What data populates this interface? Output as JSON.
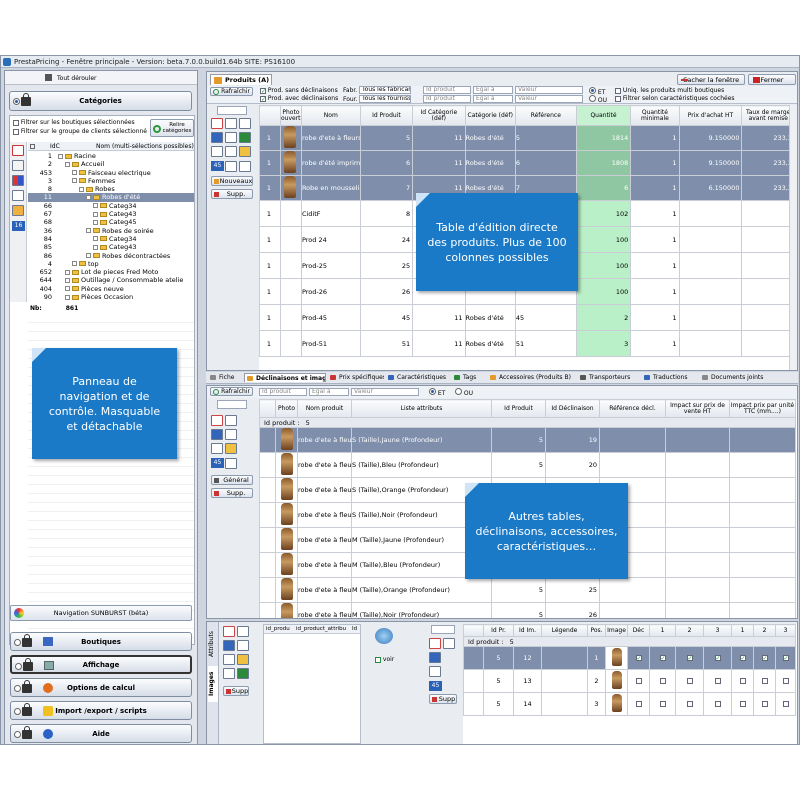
{
  "window": {
    "title": "PrestaPricing - Fenêtre principale  -  Version: beta.7.0.0.build1.64b  SITE: PS16100"
  },
  "left": {
    "expand_all": "Tout dérouler",
    "section": "Catégories",
    "filter_shops": "Filtrer sur les boutiques sélectionnées",
    "filter_groups": "Filtrer sur le groupe de clients sélectionné",
    "reread": "Relire catégories",
    "col_idc": "IdC",
    "col_name": "Nom",
    "col_name_hint": "(multi-sélections possibles)",
    "tree": [
      {
        "id": "1",
        "name": "Racine",
        "level": 0
      },
      {
        "id": "2",
        "name": "Accueil",
        "level": 1
      },
      {
        "id": "453",
        "name": "Faisceau electrique",
        "level": 2
      },
      {
        "id": "3",
        "name": "Femmes",
        "level": 2
      },
      {
        "id": "8",
        "name": "Robes",
        "level": 3
      },
      {
        "id": "11",
        "name": "Robes d'été",
        "level": 4,
        "selected": true
      },
      {
        "id": "66",
        "name": "Categ34",
        "level": 5
      },
      {
        "id": "67",
        "name": "Categ43",
        "level": 5
      },
      {
        "id": "68",
        "name": "Categ45",
        "level": 5
      },
      {
        "id": "36",
        "name": "Robes de soirée",
        "level": 4
      },
      {
        "id": "84",
        "name": "Categ34",
        "level": 5
      },
      {
        "id": "85",
        "name": "Categ43",
        "level": 5
      },
      {
        "id": "86",
        "name": "Robes décontractées",
        "level": 4
      },
      {
        "id": "4",
        "name": "top",
        "level": 2
      },
      {
        "id": "652",
        "name": "Lot de pieces Fred Moto",
        "level": 1
      },
      {
        "id": "644",
        "name": "Outillage / Consommable atelie",
        "level": 1
      },
      {
        "id": "404",
        "name": "Pièces neuve",
        "level": 1
      },
      {
        "id": "90",
        "name": "Pièces Occasion",
        "level": 1
      }
    ],
    "count_label": "Nb:",
    "count": "861",
    "side_badge": "16",
    "sunburst": "Navigation SUNBURST (béta)",
    "buttons": [
      "Boutiques",
      "Affichage",
      "Options de calcul",
      "Import /export / scripts",
      "Aide"
    ]
  },
  "products": {
    "tab": "Produits (A)",
    "hide_window": "Cacher la fenêtre",
    "close": "Fermer",
    "refresh": "Rafraîchir",
    "chk_no_decl": "Prod. sans déclinaisons",
    "chk_with_decl": "Prod. avec déclinaisons",
    "lbl_fabr": "Fabr.",
    "lbl_four": "Four.",
    "sel_fabr": "Tous les fabricant",
    "sel_four": "Tous les fournisse",
    "ph_idprod": "Id produit",
    "ph_equal": "Egal à",
    "ph_value": "Valeur",
    "opt_et": "ET",
    "opt_ou": "OU",
    "chk_multi": "Uniq. les produits multi boutiques",
    "chk_feat": "Filtrer selon caractéristiques cochées",
    "btn_new": "Nouveaux",
    "btn_del": "Supp.",
    "badge": "45",
    "headers": [
      "",
      "Photo ouverture",
      "Nom",
      "Id Produit",
      "Id Catégorie (déf)",
      "Catégorie (déf)",
      "Référence",
      "Quantité",
      "Quantité minimale",
      "Prix d'achat HT",
      "Taux de marge avant remise"
    ],
    "rows": [
      {
        "c": "1",
        "name": "robe d'ete à fleurs",
        "id": "5",
        "cat": "11",
        "catn": "Robes d'été",
        "ref": "5",
        "qty": "1814",
        "min": "1",
        "price": "9.150000",
        "rate": "233,3",
        "sel": true,
        "img": true
      },
      {
        "c": "1",
        "name": "robe d'été imprimé",
        "id": "6",
        "cat": "11",
        "catn": "Robes d'été",
        "ref": "6",
        "qty": "1808",
        "min": "1",
        "price": "9.150000",
        "rate": "233,3",
        "sel": true,
        "img": true
      },
      {
        "c": "1",
        "name": "Robe en mousselin",
        "id": "7",
        "cat": "11",
        "catn": "Robes d'été",
        "ref": "7",
        "qty": "6",
        "min": "1",
        "price": "6.150000",
        "rate": "233,3",
        "sel": true,
        "img": true
      },
      {
        "c": "1",
        "name": "CiditF",
        "id": "8",
        "cat": "",
        "catn": "",
        "ref": "",
        "qty": "102",
        "min": "1",
        "price": "",
        "rate": "",
        "sel": false,
        "img": false
      },
      {
        "c": "1",
        "name": "Prod 24",
        "id": "24",
        "cat": "",
        "catn": "",
        "ref": "",
        "qty": "100",
        "min": "1",
        "price": "",
        "rate": "",
        "sel": false,
        "img": false
      },
      {
        "c": "1",
        "name": "Prod-25",
        "id": "25",
        "cat": "",
        "catn": "",
        "ref": "",
        "qty": "100",
        "min": "1",
        "price": "",
        "rate": "",
        "sel": false,
        "img": false
      },
      {
        "c": "1",
        "name": "Prod-26",
        "id": "26",
        "cat": "",
        "catn": "",
        "ref": "",
        "qty": "100",
        "min": "1",
        "price": "",
        "rate": "",
        "sel": false,
        "img": false
      },
      {
        "c": "1",
        "name": "Prod-45",
        "id": "45",
        "cat": "11",
        "catn": "Robes d'été",
        "ref": "45",
        "qty": "2",
        "min": "1",
        "price": "",
        "rate": "",
        "sel": false,
        "img": false
      },
      {
        "c": "1",
        "name": "Prod-51",
        "id": "51",
        "cat": "11",
        "catn": "Robes d'été",
        "ref": "51",
        "qty": "3",
        "min": "1",
        "price": "",
        "rate": "",
        "sel": false,
        "img": false
      }
    ]
  },
  "tabs": [
    "Fiche",
    "Déclinaisons et images",
    "Prix spécifiques",
    "Caractéristiques",
    "Tags",
    "Accessoires (Produits B)",
    "Transporteurs",
    "Traductions",
    "Documents joints"
  ],
  "decl": {
    "refresh": "Rafraîchir",
    "ph_idprod": "Id produit",
    "ph_equal": "Egal à",
    "ph_value": "Valeur",
    "opt_et": "ET",
    "opt_ou": "OU",
    "btn_general": "Général",
    "btn_del": "Supp.",
    "badge": "45",
    "group_label": "Id produit :",
    "group_value": "5",
    "headers": [
      "Photo",
      "Nom produit",
      "Liste attributs",
      "Id Produit",
      "Id Déclinaison",
      "Référence décl.",
      "Impact sur prix de vente HT",
      "Impact prix par unité TTC (mm....)"
    ],
    "rows": [
      {
        "name": "robe d'ete à fleurs",
        "attrs": "S (Taille),Jaune (Profondeur)",
        "pid": "5",
        "did": "19",
        "sel": true
      },
      {
        "name": "robe d'ete à fleurs",
        "attrs": "S (Taille),Bleu (Profondeur)",
        "pid": "5",
        "did": "20",
        "sel": false
      },
      {
        "name": "robe d'ete à fleurs",
        "attrs": "S (Taille),Orange (Profondeur)",
        "pid": "5",
        "did": "21",
        "sel": false
      },
      {
        "name": "robe d'ete à fleurs",
        "attrs": "S (Taille),Noir (Profondeur)",
        "pid": "5",
        "did": "22",
        "sel": false
      },
      {
        "name": "robe d'ete à fleurs",
        "attrs": "M (Taille),Jaune (Profondeur)",
        "pid": "5",
        "did": "23",
        "sel": false
      },
      {
        "name": "robe d'ete à fleurs",
        "attrs": "M (Taille),Bleu (Profondeur)",
        "pid": "5",
        "did": "24",
        "sel": false
      },
      {
        "name": "robe d'ete à fleurs",
        "attrs": "M (Taille),Orange (Profondeur)",
        "pid": "5",
        "did": "25",
        "sel": false
      },
      {
        "name": "robe d'ete à fleurs",
        "attrs": "M (Taille),Noir (Profondeur)",
        "pid": "5",
        "did": "26",
        "sel": false
      }
    ]
  },
  "images": {
    "side_tabs": [
      "Attributs",
      "Images"
    ],
    "hdr_prod": "id_produ",
    "hdr_attr": "id_product_attribu",
    "hdr_extra": "Id",
    "voir": "voir",
    "btn_del": "Supp",
    "badge": "45",
    "headers": [
      "Id Pr.",
      "Id Im.",
      "Légende",
      "Pos.",
      "Image",
      "Déc",
      "1",
      "2",
      "3",
      "1",
      "2",
      "3"
    ],
    "group_label": "Id produit :",
    "group_value": "5",
    "rows": [
      {
        "pid": "5",
        "iid": "12",
        "pos": "1",
        "sel": true
      },
      {
        "pid": "5",
        "iid": "13",
        "pos": "2",
        "sel": false
      },
      {
        "pid": "5",
        "iid": "14",
        "pos": "3",
        "sel": false
      }
    ]
  },
  "callouts": {
    "products": "Table d'édition directe des produits. Plus de 100 colonnes possibles",
    "nav": "Panneau de navigation et de contrôle. Masquable et détachable",
    "other": "Autres tables, déclinaisons, accessoires, caractéristiques…"
  }
}
